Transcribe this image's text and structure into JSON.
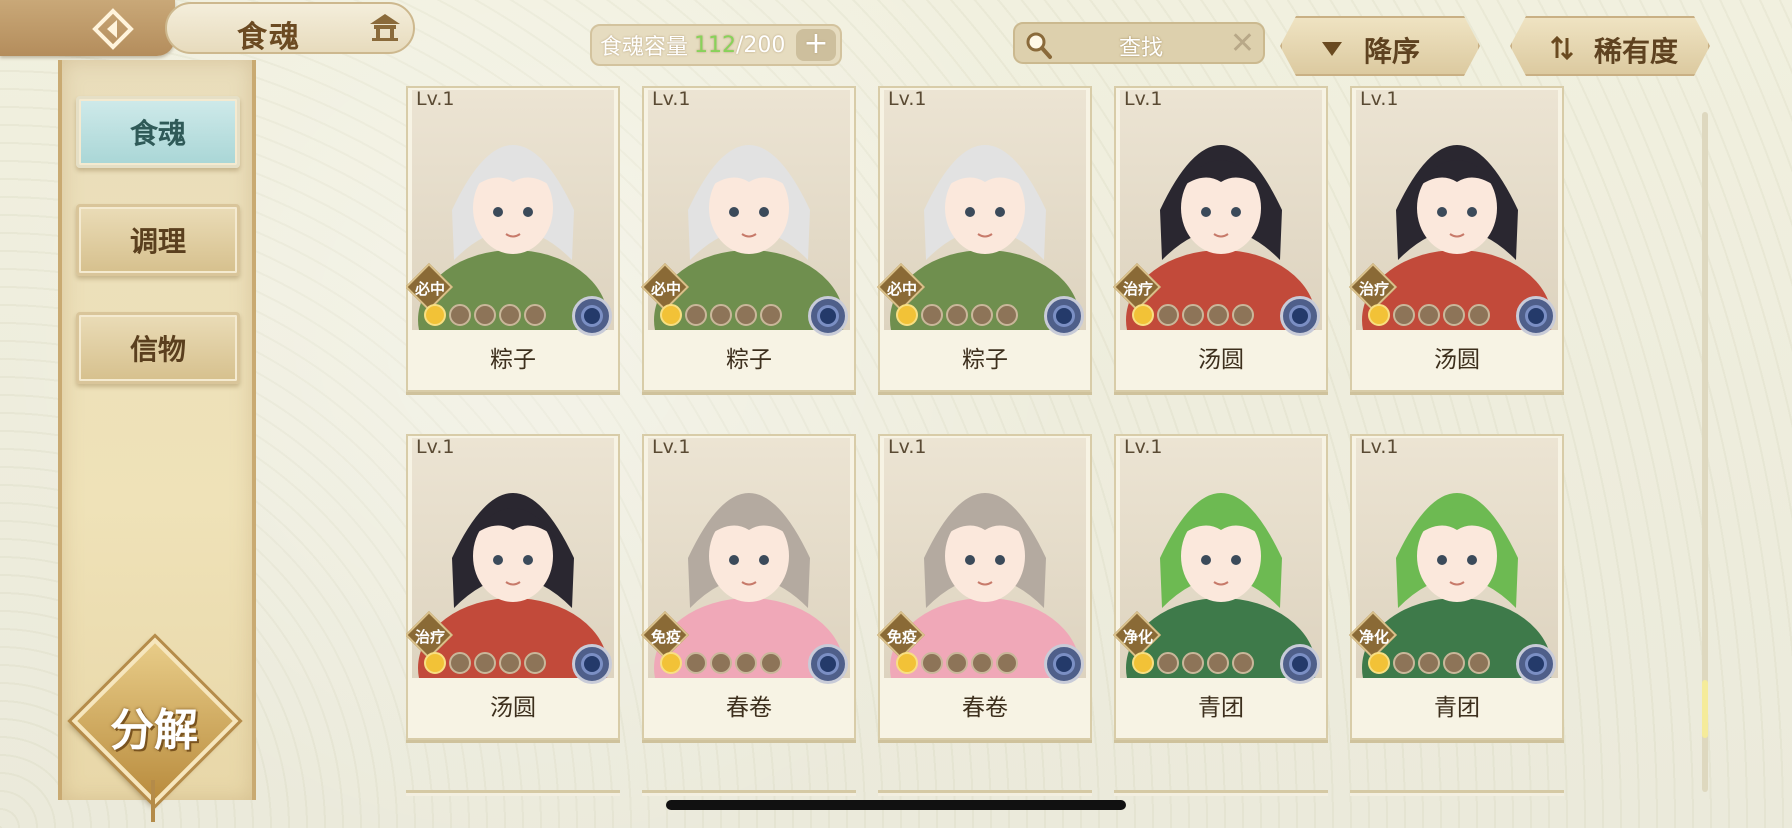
{
  "header": {
    "title": "食魂",
    "capacity_label": "食魂容量",
    "capacity_current": "112",
    "capacity_max": "/200",
    "capacity_add": "+",
    "search_placeholder": "查找",
    "search_clear": "✕",
    "sort_order_label": "降序",
    "sort_by_label": "稀有度"
  },
  "sidebar": {
    "items": [
      {
        "label": "食魂",
        "active": true
      },
      {
        "label": "调理",
        "active": false
      },
      {
        "label": "信物",
        "active": false
      }
    ],
    "decompose_label": "分解"
  },
  "cards": [
    {
      "level": "Lv.1",
      "tag": "必中",
      "name": "粽子",
      "stars_on": 1,
      "stars_total": 5,
      "hair": "#e2e2e2",
      "robe": "#6f8f4e"
    },
    {
      "level": "Lv.1",
      "tag": "必中",
      "name": "粽子",
      "stars_on": 1,
      "stars_total": 5,
      "hair": "#e2e2e2",
      "robe": "#6f8f4e"
    },
    {
      "level": "Lv.1",
      "tag": "必中",
      "name": "粽子",
      "stars_on": 1,
      "stars_total": 5,
      "hair": "#e2e2e2",
      "robe": "#6f8f4e"
    },
    {
      "level": "Lv.1",
      "tag": "治疗",
      "name": "汤圆",
      "stars_on": 1,
      "stars_total": 5,
      "hair": "#2a2730",
      "robe": "#c24a3a"
    },
    {
      "level": "Lv.1",
      "tag": "治疗",
      "name": "汤圆",
      "stars_on": 1,
      "stars_total": 5,
      "hair": "#2a2730",
      "robe": "#c24a3a"
    },
    {
      "level": "Lv.1",
      "tag": "治疗",
      "name": "汤圆",
      "stars_on": 1,
      "stars_total": 5,
      "hair": "#2a2730",
      "robe": "#c24a3a"
    },
    {
      "level": "Lv.1",
      "tag": "免疫",
      "name": "春卷",
      "stars_on": 1,
      "stars_total": 5,
      "hair": "#b4aaa0",
      "robe": "#f0a8b8"
    },
    {
      "level": "Lv.1",
      "tag": "免疫",
      "name": "春卷",
      "stars_on": 1,
      "stars_total": 5,
      "hair": "#b4aaa0",
      "robe": "#f0a8b8"
    },
    {
      "level": "Lv.1",
      "tag": "净化",
      "name": "青团",
      "stars_on": 1,
      "stars_total": 5,
      "hair": "#6dba52",
      "robe": "#3e7a4a"
    },
    {
      "level": "Lv.1",
      "tag": "净化",
      "name": "青团",
      "stars_on": 1,
      "stars_total": 5,
      "hair": "#6dba52",
      "robe": "#3e7a4a"
    }
  ],
  "icons": {
    "back": "back-arrow-icon",
    "home": "pavilion-icon",
    "search": "magnifier-icon",
    "sort_order": "triangle-down-icon",
    "sort_by": "swap-arrows-icon",
    "emblem": "flower-emblem-icon"
  },
  "colors": {
    "accent_gold": "#c9a878",
    "active_tab": "#a9d6d6",
    "capacity_current": "#88d25a"
  }
}
